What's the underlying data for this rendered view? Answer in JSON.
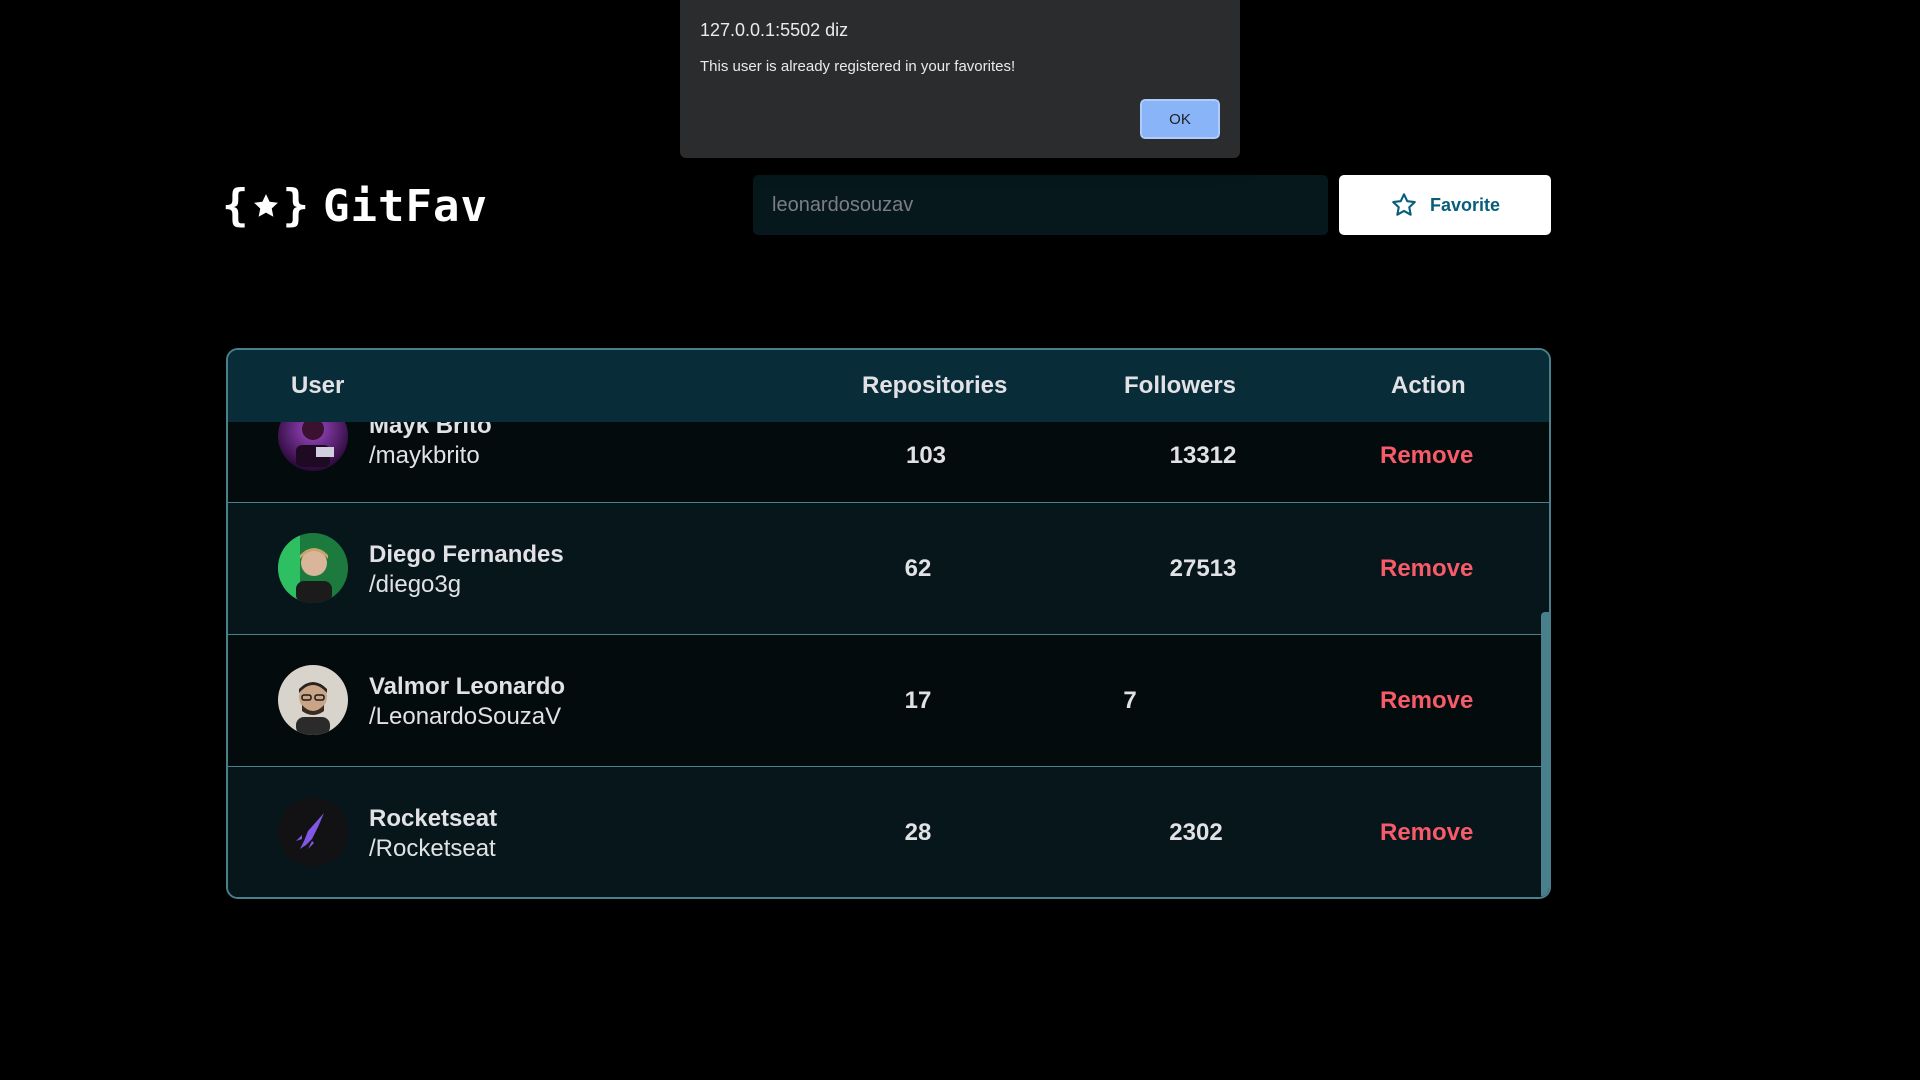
{
  "app": {
    "logo_text": "GitFav",
    "logo_icon": "braces-star-icon"
  },
  "search": {
    "value": "leonardosouzav"
  },
  "favorite_button": {
    "label": "Favorite",
    "icon": "star-outline-icon"
  },
  "table": {
    "headers": {
      "user": "User",
      "repositories": "Repositories",
      "followers": "Followers",
      "action": "Action"
    },
    "rows": [
      {
        "name": "Mayk Brito",
        "login": "/maykbrito",
        "repositories": "103",
        "followers": "13312",
        "action": "Remove"
      },
      {
        "name": "Diego Fernandes",
        "login": "/diego3g",
        "repositories": "62",
        "followers": "27513",
        "action": "Remove"
      },
      {
        "name": "Valmor Leonardo",
        "login": "/LeonardoSouzaV",
        "repositories": "17",
        "followers": "7",
        "action": "Remove"
      },
      {
        "name": "Rocketseat",
        "login": "/Rocketseat",
        "repositories": "28",
        "followers": "2302",
        "action": "Remove"
      }
    ]
  },
  "dialog": {
    "origin": "127.0.0.1:5502 diz",
    "message": "This user is already registered in your favorites!",
    "ok_label": "OK"
  },
  "colors": {
    "background": "#000000",
    "header_bg": "#092D38",
    "row_odd": "#06161B",
    "row_even": "#030B0D",
    "border": "#4A808C",
    "remove": "#F75A68",
    "favorite_text": "#065E7C",
    "dialog_bg": "#2B2C2E",
    "dialog_ok": "#8AB4F8"
  }
}
